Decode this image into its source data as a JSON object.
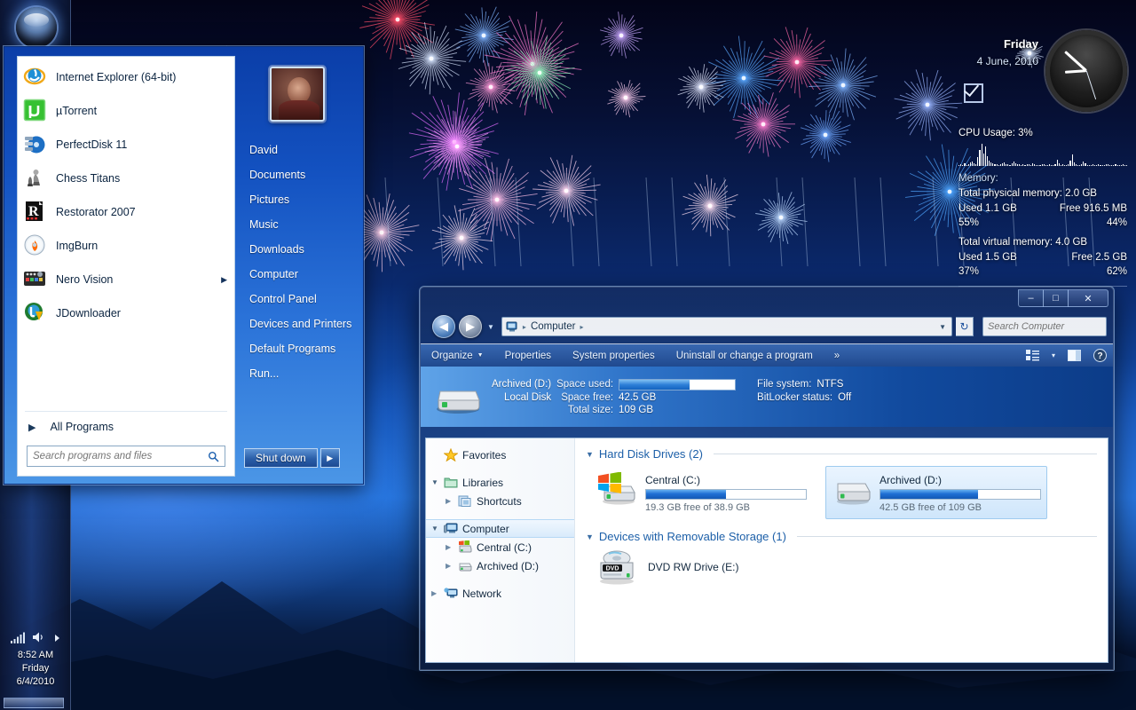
{
  "desktop": {
    "wallpaper_description": "fireworks-night-sky"
  },
  "taskbar": {
    "orb_name": "start-orb",
    "tray": {
      "network_icon": "network-signal-icon",
      "volume_icon": "volume-icon",
      "overflow_icon": "show-hidden-icons-icon",
      "time": "8:52 AM",
      "day": "Friday",
      "date": "6/4/2010"
    },
    "show_desktop_label": ""
  },
  "start_menu": {
    "programs": [
      {
        "label": "Internet Explorer (64-bit)",
        "icon": "internet-explorer-icon",
        "has_submenu": false
      },
      {
        "label": "µTorrent",
        "icon": "utorrent-icon",
        "has_submenu": false
      },
      {
        "label": "PerfectDisk 11",
        "icon": "perfectdisk-icon",
        "has_submenu": false
      },
      {
        "label": "Chess Titans",
        "icon": "chess-titans-icon",
        "has_submenu": false
      },
      {
        "label": "Restorator 2007",
        "icon": "restorator-icon",
        "has_submenu": false
      },
      {
        "label": "ImgBurn",
        "icon": "imgburn-icon",
        "has_submenu": false
      },
      {
        "label": "Nero Vision",
        "icon": "nero-vision-icon",
        "has_submenu": true
      },
      {
        "label": "JDownloader",
        "icon": "jdownloader-icon",
        "has_submenu": false
      }
    ],
    "all_programs_label": "All Programs",
    "search_placeholder": "Search programs and files",
    "search_value": "",
    "user_name": "David",
    "right_links": [
      "David",
      "Documents",
      "Pictures",
      "Music",
      "Downloads",
      "Computer",
      "Control Panel",
      "Devices and Printers",
      "Default Programs",
      "Run..."
    ],
    "shutdown_label": "Shut down",
    "shutdown_arrow": "▶"
  },
  "gadgets": {
    "clock": {
      "day": "Friday",
      "date": "4 June, 2010",
      "time_hour": 8,
      "time_minute": 52
    },
    "checkbox": {
      "name": "checkbox-gadget",
      "checked": true
    },
    "resource_monitor": {
      "cpu_line": "CPU Usage: 3%",
      "memory_heading": "Memory:",
      "total_physical": "Total physical memory: 2.0 GB",
      "phys_used": "Used 1.1 GB",
      "phys_free": "Free 916.5 MB",
      "phys_used_pct": "55%",
      "phys_free_pct": "44%",
      "total_virtual": "Total virtual memory: 4.0 GB",
      "virt_used": "Used 1.5 GB",
      "virt_free": "Free 2.5 GB",
      "virt_used_pct": "37%",
      "virt_free_pct": "62%",
      "cpu_history": [
        3,
        4,
        2,
        6,
        3,
        5,
        8,
        12,
        6,
        4,
        22,
        40,
        55,
        30,
        48,
        24,
        14,
        9,
        6,
        4,
        5,
        3,
        4,
        6,
        9,
        5,
        4,
        3,
        6,
        12,
        7,
        4,
        5,
        3,
        4,
        3,
        5,
        4,
        3,
        6,
        4,
        3,
        2,
        3,
        5,
        4,
        3,
        2,
        4,
        3,
        2,
        5,
        16,
        6,
        3,
        4,
        2,
        3,
        4,
        14,
        28,
        8,
        4,
        3,
        2,
        5,
        12,
        7,
        3,
        2,
        3,
        4,
        3,
        2,
        4,
        3,
        2,
        3,
        5,
        4,
        3,
        2,
        3,
        4,
        3,
        2,
        3,
        4,
        2,
        3
      ]
    }
  },
  "explorer": {
    "window_controls": {
      "minimize": "–",
      "maximize": "□",
      "close": "✕"
    },
    "nav": {
      "back_icon": "back-arrow-icon",
      "forward_icon": "forward-arrow-icon",
      "history_icon": "recent-pages-icon",
      "refresh_icon": "refresh-icon"
    },
    "address": {
      "root_icon": "computer-icon",
      "crumbs": [
        "Computer"
      ],
      "sep": "▸"
    },
    "search": {
      "placeholder": "Search Computer",
      "value": "",
      "icon": "search-icon"
    },
    "commands": [
      {
        "label": "Organize",
        "has_caret": true
      },
      {
        "label": "Properties",
        "has_caret": false
      },
      {
        "label": "System properties",
        "has_caret": false
      },
      {
        "label": "Uninstall or change a program",
        "has_caret": false
      },
      {
        "label": "»",
        "has_caret": false
      }
    ],
    "toolbar_icons": {
      "views": "change-view-icon",
      "views_caret": "▾",
      "preview": "preview-pane-icon",
      "help": "help-icon"
    },
    "details_pane": {
      "icon": "hard-disk-icon",
      "title": "Archived (D:)",
      "subtitle": "Local Disk",
      "rows": [
        {
          "label": "Space used:",
          "value": "",
          "is_bar": true,
          "bar_pct": 61
        },
        {
          "label": "Space free:",
          "value": "42.5 GB",
          "is_bar": false
        },
        {
          "label": "Total size:",
          "value": "109 GB",
          "is_bar": false
        }
      ],
      "right_rows": [
        {
          "label": "File system:",
          "value": "NTFS"
        },
        {
          "label": "BitLocker status:",
          "value": "Off"
        }
      ]
    },
    "tree": [
      {
        "label": "Favorites",
        "icon": "favorites-star-icon",
        "indent": 0,
        "tri": "none",
        "selected": false
      },
      {
        "gap": true
      },
      {
        "label": "Libraries",
        "icon": "libraries-icon",
        "indent": 0,
        "tri": "open",
        "selected": false
      },
      {
        "label": "Shortcuts",
        "icon": "shortcuts-library-icon",
        "indent": 1,
        "tri": "closed",
        "selected": false
      },
      {
        "gap": true
      },
      {
        "label": "Computer",
        "icon": "computer-icon",
        "indent": 0,
        "tri": "open",
        "selected": true
      },
      {
        "label": "Central (C:)",
        "icon": "windows-drive-icon",
        "indent": 1,
        "tri": "closed",
        "selected": false
      },
      {
        "label": "Archived (D:)",
        "icon": "hard-disk-icon",
        "indent": 1,
        "tri": "closed",
        "selected": false
      },
      {
        "gap": true
      },
      {
        "label": "Network",
        "icon": "network-icon",
        "indent": 0,
        "tri": "closed",
        "selected": false
      }
    ],
    "groups": [
      {
        "title": "Hard Disk Drives (2)",
        "kind": "drives",
        "items": [
          {
            "name": "Central (C:)",
            "icon": "windows-drive-icon",
            "free_text": "19.3 GB free of 38.9 GB",
            "used_pct": 50,
            "selected": false
          },
          {
            "name": "Archived (D:)",
            "icon": "hard-disk-icon",
            "free_text": "42.5 GB free of 109 GB",
            "used_pct": 61,
            "selected": true
          }
        ]
      },
      {
        "title": "Devices with Removable Storage (1)",
        "kind": "devices",
        "items": [
          {
            "name": "DVD RW Drive (E:)",
            "icon": "dvd-drive-icon"
          }
        ]
      }
    ]
  },
  "colors": {
    "accent_blue": "#1f6fd4",
    "startmenu_blue": "#1351c0",
    "explorer_detail_blue": "#114a9e",
    "group_header": "#1c5fa8",
    "selection": "#cfe6fb"
  }
}
